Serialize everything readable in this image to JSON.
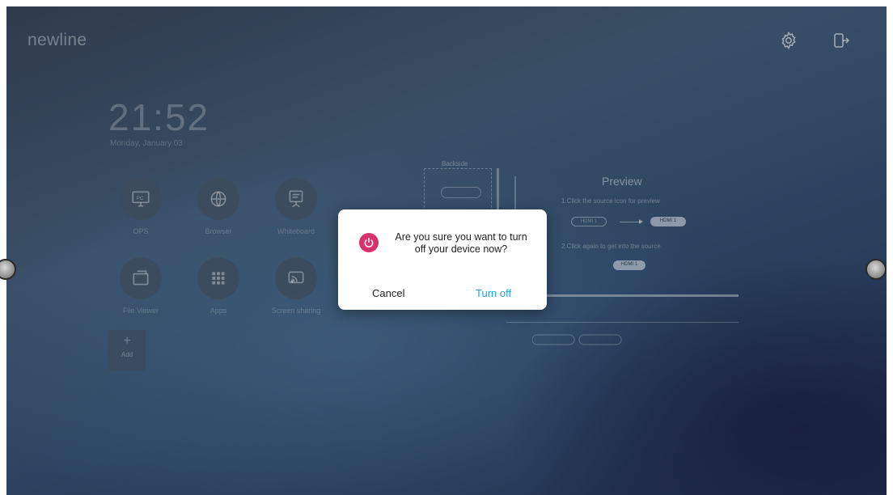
{
  "brand": {
    "logo_text": "newline"
  },
  "top_bar": {
    "settings_icon": "gear-icon",
    "exit_icon": "exit-icon"
  },
  "clock": {
    "time": "21:52",
    "date": "Monday, January 03"
  },
  "apps": [
    {
      "label": "OPS",
      "icon": "pc-icon"
    },
    {
      "label": "Browser",
      "icon": "globe-icon"
    },
    {
      "label": "Whiteboard",
      "icon": "whiteboard-icon"
    },
    {
      "label": "File Viewer",
      "icon": "folder-icon"
    },
    {
      "label": "Apps",
      "icon": "grid-icon"
    },
    {
      "label": "Screen sharing",
      "icon": "screen-cast-icon"
    }
  ],
  "add_tile": {
    "symbol": "+",
    "label": "Add"
  },
  "preview": {
    "backside_label": "Backside",
    "title": "Preview",
    "step1": "1.Click the source icon for preview",
    "step2": "2.Click again to get into the source",
    "pill1": "HDMI 1",
    "pill2": "HDMI 1",
    "pill3": "HDMI 1"
  },
  "dialog": {
    "icon": "power-icon",
    "message": "Are you sure you want to turn off your device now?",
    "cancel_label": "Cancel",
    "confirm_label": "Turn off",
    "icon_color": "#d6336c",
    "confirm_color": "#1ea4d8"
  }
}
